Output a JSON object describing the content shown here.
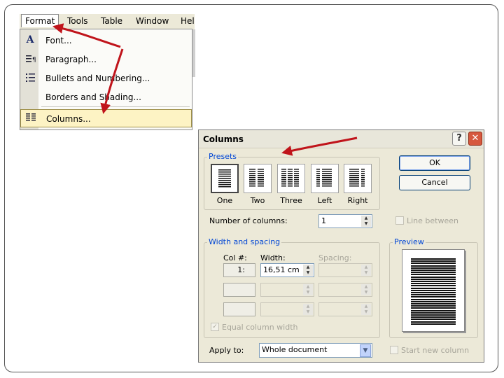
{
  "menubar": {
    "items": [
      "Format",
      "Tools",
      "Table",
      "Window",
      "Help"
    ]
  },
  "format_menu": {
    "items": [
      {
        "label": "Font...",
        "icon": "font-A-icon"
      },
      {
        "label": "Paragraph...",
        "icon": "paragraph-icon"
      },
      {
        "label": "Bullets and Numbering...",
        "icon": "bullets-icon"
      },
      {
        "label": "Borders and Shading...",
        "icon": ""
      },
      {
        "label": "Columns...",
        "icon": "columns-icon"
      }
    ]
  },
  "dialog": {
    "title": "Columns",
    "presets_label": "Presets",
    "presets": [
      "One",
      "Two",
      "Three",
      "Left",
      "Right"
    ],
    "ok": "OK",
    "cancel": "Cancel",
    "num_columns_label": "Number of columns:",
    "num_columns_value": "1",
    "line_between": "Line between",
    "width_spacing_label": "Width and spacing",
    "col_header": "Col #:",
    "width_header": "Width:",
    "spacing_header": "Spacing:",
    "col1": "1:",
    "width1": "16,51 cm",
    "equal_width": "Equal column width",
    "preview_label": "Preview",
    "apply_label": "Apply to:",
    "apply_value": "Whole document",
    "start_new": "Start new column"
  },
  "colors": {
    "arrow": "#c0141b",
    "group_label": "#0046d5",
    "highlight": "#fdf3c4"
  }
}
